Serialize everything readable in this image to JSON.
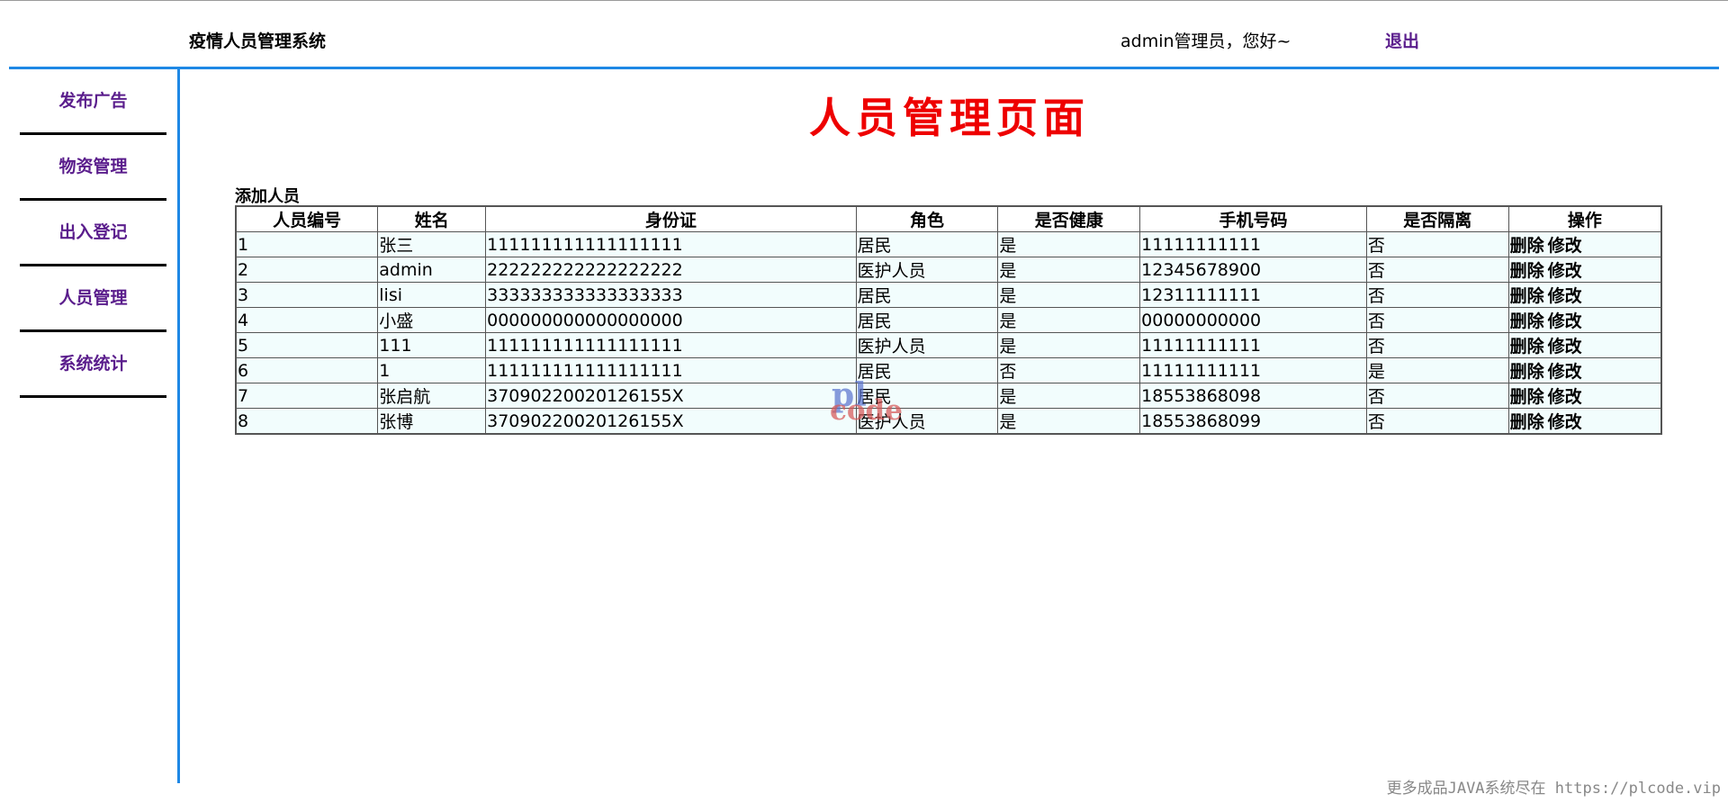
{
  "header": {
    "app_title": "疫情人员管理系统",
    "greeting": "admin管理员，您好~",
    "logout_label": "退出"
  },
  "sidebar": {
    "items": [
      {
        "label": "发布广告"
      },
      {
        "label": "物资管理"
      },
      {
        "label": "出入登记"
      },
      {
        "label": "人员管理"
      },
      {
        "label": "系统统计"
      }
    ]
  },
  "main": {
    "page_title": "人员管理页面",
    "add_label": "添加人员",
    "table": {
      "columns": [
        "人员编号",
        "姓名",
        "身份证",
        "角色",
        "是否健康",
        "手机号码",
        "是否隔离",
        "操作"
      ],
      "rows": [
        {
          "id": "1",
          "name": "张三",
          "id_card": "111111111111111111",
          "role": "居民",
          "healthy": "是",
          "phone": "11111111111",
          "quarantined": "否"
        },
        {
          "id": "2",
          "name": "admin",
          "id_card": "222222222222222222",
          "role": "医护人员",
          "healthy": "是",
          "phone": "12345678900",
          "quarantined": "否"
        },
        {
          "id": "3",
          "name": "lisi",
          "id_card": "333333333333333333",
          "role": "居民",
          "healthy": "是",
          "phone": "12311111111",
          "quarantined": "否"
        },
        {
          "id": "4",
          "name": "小盛",
          "id_card": "000000000000000000",
          "role": "居民",
          "healthy": "是",
          "phone": "00000000000",
          "quarantined": "否"
        },
        {
          "id": "5",
          "name": "111",
          "id_card": "111111111111111111",
          "role": "医护人员",
          "healthy": "是",
          "phone": "11111111111",
          "quarantined": "否"
        },
        {
          "id": "6",
          "name": "1",
          "id_card": "111111111111111111",
          "role": "居民",
          "healthy": "否",
          "phone": "11111111111",
          "quarantined": "是"
        },
        {
          "id": "7",
          "name": "张启航",
          "id_card": "37090220020126155X",
          "role": "居民",
          "healthy": "是",
          "phone": "18553868098",
          "quarantined": "否"
        },
        {
          "id": "8",
          "name": "张博",
          "id_card": "37090220020126155X",
          "role": "医护人员",
          "healthy": "是",
          "phone": "18553868099",
          "quarantined": "否"
        }
      ],
      "actions": {
        "delete_label": "删除",
        "edit_label": "修改"
      }
    }
  },
  "watermark": {
    "top": "pl",
    "bottom": "code"
  },
  "footer": {
    "note": "更多成品JAVA系统尽在 https://plcode.vip"
  },
  "colors": {
    "accent": "#1e88e5",
    "nav_text": "#5a1d8c",
    "title": "#ee0000",
    "cell_bg": "#f2fdfd"
  }
}
